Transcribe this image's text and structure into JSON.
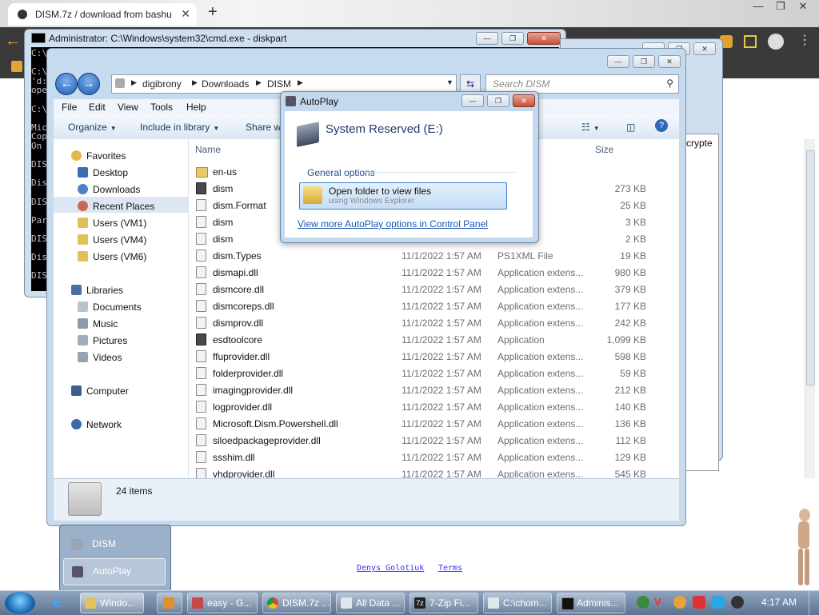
{
  "browser": {
    "tab_title": "DISM.7z / download from bashu",
    "tab_close": "✕",
    "new_tab": "+",
    "footer_links": [
      "Denys Golotiuk",
      "Terms"
    ]
  },
  "cmd": {
    "title": "Administrator: C:\\Windows\\system32\\cmd.exe - diskpart",
    "lines": [
      "C:\\",
      "",
      "C:\\",
      "'d:",
      "ope",
      "",
      "C:\\",
      "",
      "Mic",
      "Cop",
      "On",
      "",
      "DIS",
      "",
      "Dis",
      "",
      "DIS",
      "",
      "Par",
      "",
      "DIS",
      "",
      "Dis",
      "",
      "DIS"
    ]
  },
  "zip": {
    "column_label": "crypte"
  },
  "explorer": {
    "breadcrumb": [
      "digibrony",
      "Downloads",
      "DISM"
    ],
    "search_placeholder": "Search DISM",
    "menu": [
      "File",
      "Edit",
      "View",
      "Tools",
      "Help"
    ],
    "toolbar": {
      "organize": "Organize",
      "include": "Include in library",
      "share": "Share wi"
    },
    "nav": {
      "favorites": "Favorites",
      "fav_items": [
        "Desktop",
        "Downloads",
        "Recent Places",
        "Users (VM1)",
        "Users (VM4)",
        "Users (VM6)"
      ],
      "libraries": "Libraries",
      "lib_items": [
        "Documents",
        "Music",
        "Pictures",
        "Videos"
      ],
      "computer": "Computer",
      "network": "Network"
    },
    "columns": {
      "name": "Name",
      "size": "Size"
    },
    "files": [
      {
        "name": "en-us",
        "date": "",
        "type": "",
        "size": "",
        "icon": "folder"
      },
      {
        "name": "dism",
        "date": "",
        "type": "ion",
        "size": "273 KB",
        "icon": "dark"
      },
      {
        "name": "dism.Format",
        "date": "",
        "type": "File",
        "size": "25 KB",
        "icon": "file"
      },
      {
        "name": "dism",
        "date": "",
        "type": "",
        "size": "3 KB",
        "icon": "file"
      },
      {
        "name": "dism",
        "date": "",
        "type": "",
        "size": "2 KB",
        "icon": "file"
      },
      {
        "name": "dism.Types",
        "date": "11/1/2022 1:57 AM",
        "type": "PS1XML File",
        "size": "19 KB",
        "icon": "file"
      },
      {
        "name": "dismapi.dll",
        "date": "11/1/2022 1:57 AM",
        "type": "Application extens...",
        "size": "980 KB",
        "icon": "file"
      },
      {
        "name": "dismcore.dll",
        "date": "11/1/2022 1:57 AM",
        "type": "Application extens...",
        "size": "379 KB",
        "icon": "file"
      },
      {
        "name": "dismcoreps.dll",
        "date": "11/1/2022 1:57 AM",
        "type": "Application extens...",
        "size": "177 KB",
        "icon": "file"
      },
      {
        "name": "dismprov.dll",
        "date": "11/1/2022 1:57 AM",
        "type": "Application extens...",
        "size": "242 KB",
        "icon": "file"
      },
      {
        "name": "esdtoolcore",
        "date": "11/1/2022 1:57 AM",
        "type": "Application",
        "size": "1,099 KB",
        "icon": "dark"
      },
      {
        "name": "ffuprovider.dll",
        "date": "11/1/2022 1:57 AM",
        "type": "Application extens...",
        "size": "598 KB",
        "icon": "file"
      },
      {
        "name": "folderprovider.dll",
        "date": "11/1/2022 1:57 AM",
        "type": "Application extens...",
        "size": "59 KB",
        "icon": "file"
      },
      {
        "name": "imagingprovider.dll",
        "date": "11/1/2022 1:57 AM",
        "type": "Application extens...",
        "size": "212 KB",
        "icon": "file"
      },
      {
        "name": "logprovider.dll",
        "date": "11/1/2022 1:57 AM",
        "type": "Application extens...",
        "size": "140 KB",
        "icon": "file"
      },
      {
        "name": "Microsoft.Dism.Powershell.dll",
        "date": "11/1/2022 1:57 AM",
        "type": "Application extens...",
        "size": "136 KB",
        "icon": "file"
      },
      {
        "name": "siloedpackageprovider.dll",
        "date": "11/1/2022 1:57 AM",
        "type": "Application extens...",
        "size": "112 KB",
        "icon": "file"
      },
      {
        "name": "ssshim.dll",
        "date": "11/1/2022 1:57 AM",
        "type": "Application extens...",
        "size": "129 KB",
        "icon": "file"
      },
      {
        "name": "vhdprovider.dll",
        "date": "11/1/2022 1:57 AM",
        "type": "Application extens...",
        "size": "545 KB",
        "icon": "file"
      }
    ],
    "item_count": "24 items"
  },
  "autoplay": {
    "title": "AutoPlay",
    "drive_name": "System Reserved (E:)",
    "section": "General options",
    "option_title": "Open folder to view files",
    "option_sub": "using Windows Explorer",
    "link": "View more AutoPlay options in Control Panel"
  },
  "taskbar": {
    "popup_items": [
      "DISM",
      "AutoPlay"
    ],
    "buttons": [
      "Windo...",
      "",
      "easy - G...",
      "DISM.7z ...",
      "All Data ...",
      "7-Zip Fi...",
      "C:\\chom...",
      "Adminis..."
    ],
    "clock": "4:17 AM"
  }
}
